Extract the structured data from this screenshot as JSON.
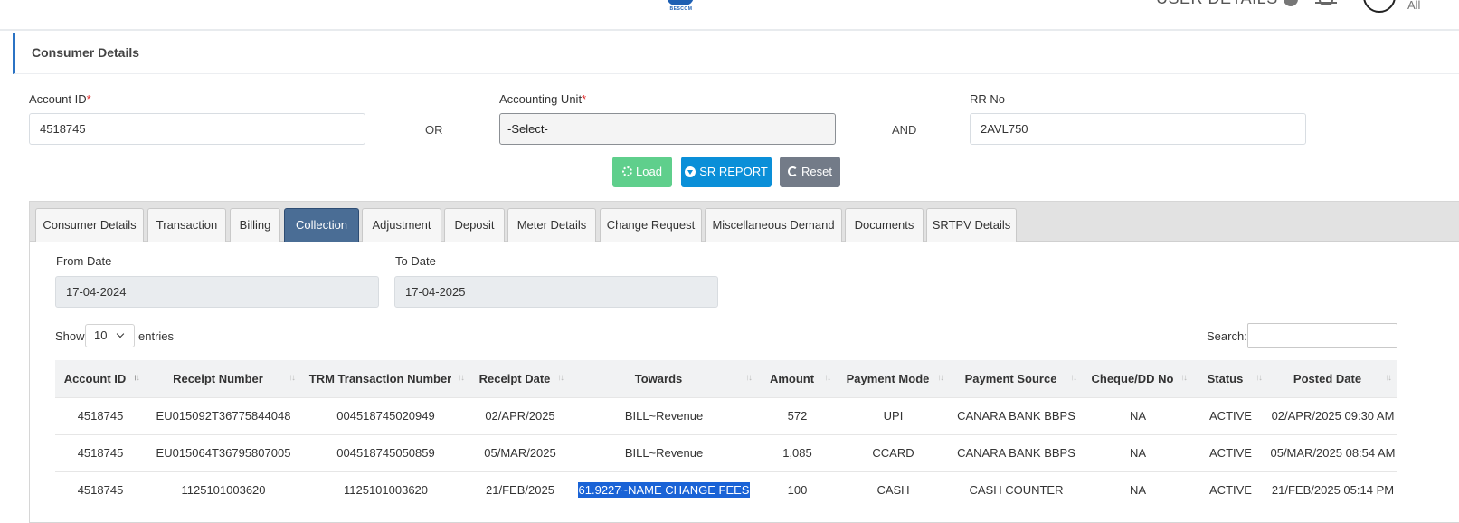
{
  "topbar": {
    "logo_text": "BESCOM",
    "user_details_label": "USER DETAILS",
    "all_label": "All"
  },
  "card": {
    "title": "Consumer Details"
  },
  "form": {
    "account_id_label": "Account ID",
    "account_id_value": "4518745",
    "or_label": "OR",
    "accounting_unit_label": "Accounting Unit",
    "accounting_unit_value": "-Select-",
    "and_label": "AND",
    "rr_no_label": "RR No",
    "rr_no_value": "2AVL750",
    "required_mark": "*"
  },
  "buttons": {
    "load": "Load",
    "sr_report": "SR REPORT",
    "reset": "Reset"
  },
  "tabs": [
    "Consumer Details",
    "Transaction",
    "Billing",
    "Collection",
    "Adjustment",
    "Deposit",
    "Meter Details",
    "Change Request",
    "Miscellaneous Demand",
    "Documents",
    "SRTPV Details"
  ],
  "active_tab": "Collection",
  "filters": {
    "from_date_label": "From Date",
    "from_date_value": "17-04-2024",
    "to_date_label": "To Date",
    "to_date_value": "17-04-2025"
  },
  "table_controls": {
    "show_label": "Show",
    "entries_value": "10",
    "entries_label": "entries",
    "search_label": "Search:"
  },
  "table": {
    "columns": [
      "Account ID",
      "Receipt Number",
      "TRM Transaction Number",
      "Receipt Date",
      "Towards",
      "Amount",
      "Payment Mode",
      "Payment Source",
      "Cheque/DD No",
      "Status",
      "Posted Date"
    ],
    "rows": [
      [
        "4518745",
        "EU015092T36775844048",
        "004518745020949",
        "02/APR/2025",
        "BILL~Revenue",
        "572",
        "UPI",
        "CANARA BANK BBPS",
        "NA",
        "ACTIVE",
        "02/APR/2025 09:30 AM"
      ],
      [
        "4518745",
        "EU015064T36795807005",
        "004518745050859",
        "05/MAR/2025",
        "BILL~Revenue",
        "1,085",
        "CCARD",
        "CANARA BANK BBPS",
        "NA",
        "ACTIVE",
        "05/MAR/2025 08:54 AM"
      ],
      [
        "4518745",
        "1125101003620",
        "1125101003620",
        "21/FEB/2025",
        "61.9227~NAME CHANGE FEES",
        "100",
        "CASH",
        "CASH COUNTER",
        "NA",
        "ACTIVE",
        "21/FEB/2025 05:14 PM"
      ]
    ]
  }
}
